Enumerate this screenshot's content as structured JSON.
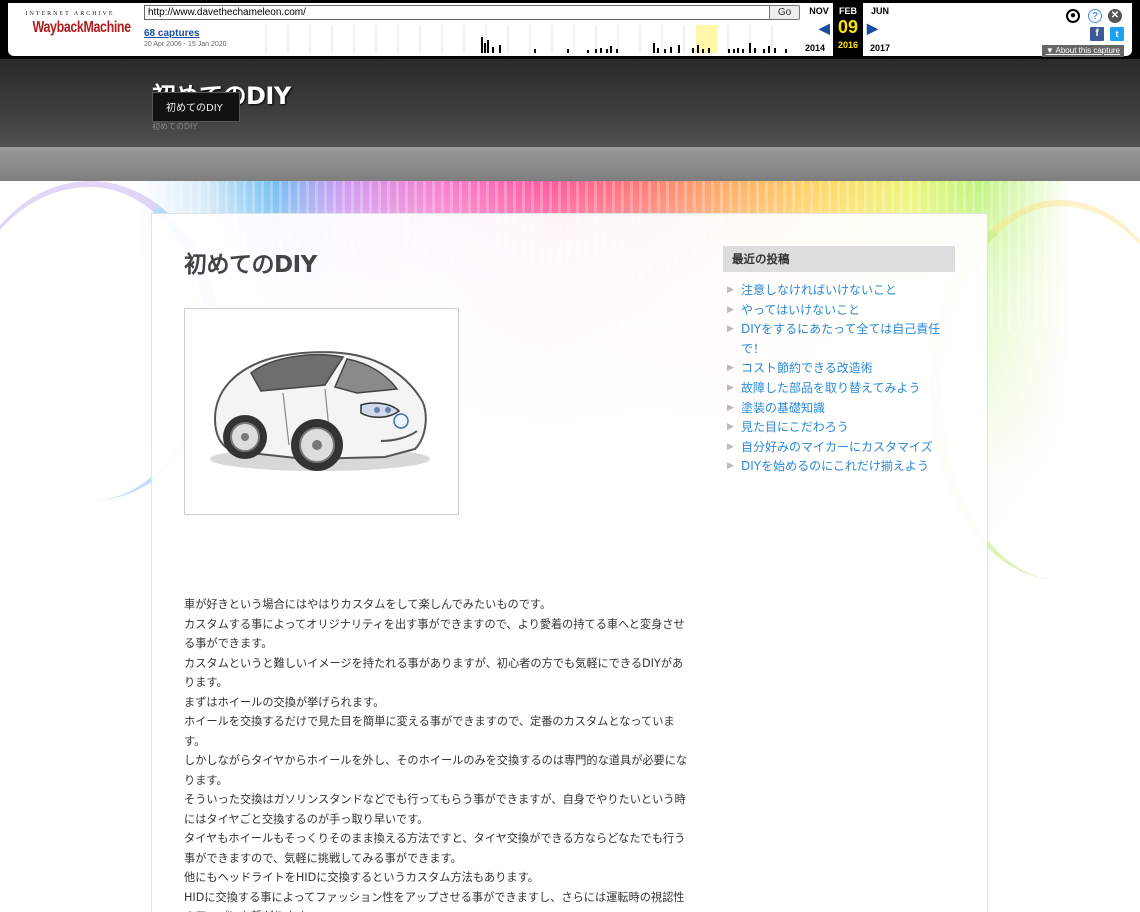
{
  "wayback": {
    "logo_top": "INTERNET ARCHIVE",
    "logo_main": "WaybackMachine",
    "url": "http://www.davethechameleon.com/",
    "go_label": "Go",
    "captures_count": "68 captures",
    "captures_range": "20 Apr 2006 - 15 Jan 2020",
    "months": {
      "prev": "NOV",
      "current": "FEB",
      "next": "JUN"
    },
    "day": "09",
    "years": {
      "prev": "2014",
      "current": "2016",
      "next": "2017"
    },
    "about_label": "About this capture",
    "colors": {
      "current_bg": "#000000",
      "highlight": "#ffe400",
      "link": "#1a4ea3"
    }
  },
  "site": {
    "title": "初めてのDIY",
    "tooltip": "初めてのDIY",
    "description": "初めてのDIY"
  },
  "main": {
    "page_title": "初めてのDIY",
    "paragraphs": [
      "車が好きという場合にはやはりカスタムをして楽しんでみたいものです。",
      "カスタムする事によってオリジナリティを出す事ができますので、より愛着の持てる車へと変身させる事ができます。",
      "カスタムというと難しいイメージを持たれる事がありますが、初心者の方でも気軽にできるDIYがあります。",
      "まずはホイールの交換が挙げられます。",
      "ホイールを交換するだけで見た目を簡単に変える事ができますので、定番のカスタムとなっています。",
      "しかしながらタイヤからホイールを外し、そのホイールのみを交換するのは専門的な道具が必要になります。",
      "そういった交換はガソリンスタンドなどでも行ってもらう事ができますが、自身でやりたいという時にはタイヤごと交換するのが手っ取り早いです。",
      "タイヤもホイールもそっくりそのまま換える方法ですと、タイヤ交換ができる方ならどなたでも行う事ができますので、気軽に挑戦してみる事ができます。",
      "他にもヘッドライトをHIDに交換するというカスタム方法もあります。",
      "HIDに交換する事によってファッション性をアップさせる事ができますし、さらには運転時の視認性のアップにも繋がります。"
    ]
  },
  "sidebar": {
    "heading": "最近の投稿",
    "posts": [
      "注意しなければいけないこと",
      "やってはいけないこと",
      "DIYをするにあたって全ては自己責任で！",
      "コスト節約できる改造術",
      "故障した部品を取り替えてみよう",
      "塗装の基礎知識",
      "見た目にこだわろう",
      "自分好みのマイカーにカスタマイズ",
      "DIYを始めるのにこれだけ揃えよう"
    ],
    "link_color": "#2a8ad8"
  }
}
